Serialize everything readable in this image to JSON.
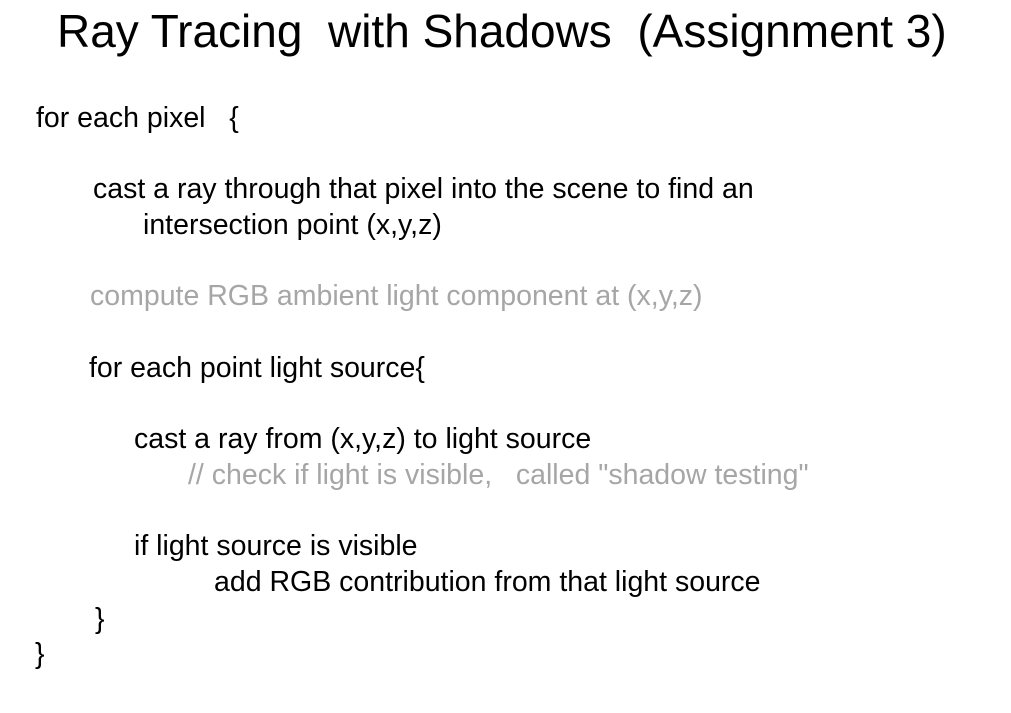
{
  "slide": {
    "title": "Ray Tracing  with Shadows  (Assignment 3)",
    "lines": [
      {
        "text": "for each pixel   {",
        "style": "normal"
      },
      {
        "text": "cast a ray through that pixel into the scene to find an",
        "style": "normal"
      },
      {
        "text": "intersection point (x,y,z)",
        "style": "normal"
      },
      {
        "text": "compute RGB ambient light component at (x,y,z)",
        "style": "muted"
      },
      {
        "text": "for each point light source{",
        "style": "normal"
      },
      {
        "text": "cast a ray from (x,y,z) to light source",
        "style": "normal"
      },
      {
        "text": "// check if light is visible,   called \"shadow testing\"",
        "style": "muted"
      },
      {
        "text": "if light source is visible",
        "style": "normal"
      },
      {
        "text": "add RGB contribution from that light source",
        "style": "normal"
      },
      {
        "text": "}",
        "style": "normal"
      },
      {
        "text": "}",
        "style": "normal"
      }
    ]
  },
  "colors": {
    "text": "#000000",
    "muted_text": "#a6a6a6",
    "background": "#ffffff"
  }
}
